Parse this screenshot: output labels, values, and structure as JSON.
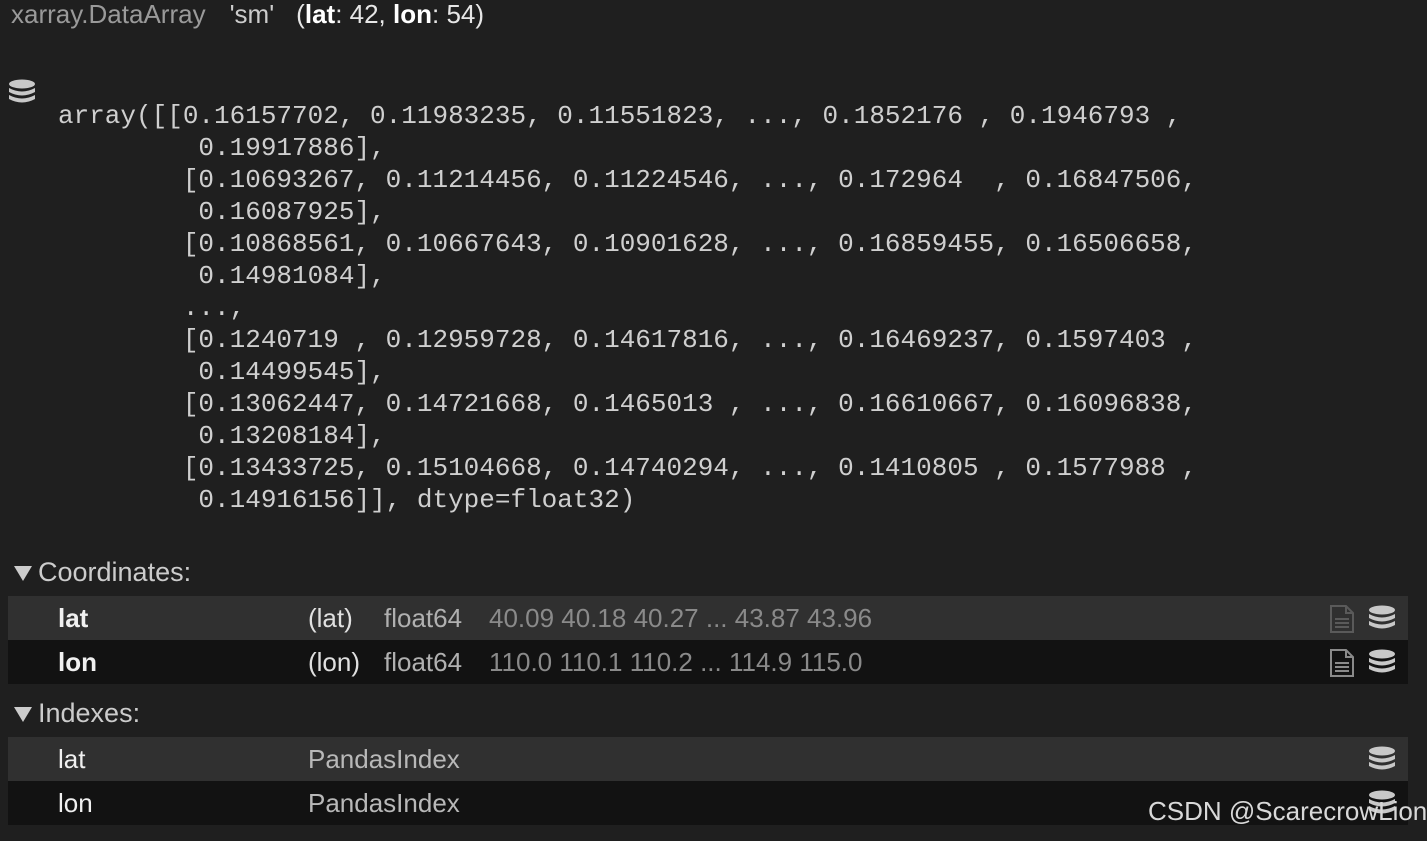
{
  "header": {
    "class_name": "xarray.DataArray",
    "var_name": "'sm'",
    "dims_open": "(",
    "dim1_name": "lat",
    "dim1_size": ": 42, ",
    "dim2_name": "lon",
    "dim2_size": ": 54)"
  },
  "array_repr": "array([[0.16157702, 0.11983235, 0.11551823, ..., 0.1852176 , 0.1946793 ,\n         0.19917886],\n        [0.10693267, 0.11214456, 0.11224546, ..., 0.172964  , 0.16847506,\n         0.16087925],\n        [0.10868561, 0.10667643, 0.10901628, ..., 0.16859455, 0.16506658,\n         0.14981084],\n        ...,\n        [0.1240719 , 0.12959728, 0.14617816, ..., 0.16469237, 0.1597403 ,\n         0.14499545],\n        [0.13062447, 0.14721668, 0.1465013 , ..., 0.16610667, 0.16096838,\n         0.13208184],\n        [0.13433725, 0.15104668, 0.14740294, ..., 0.1410805 , 0.1577988 ,\n         0.14916156]], dtype=float32)",
  "coordinates": {
    "title": "Coordinates:",
    "rows": [
      {
        "name": "lat",
        "dims": "(lat)",
        "dtype": "float64",
        "preview": "40.09 40.18 40.27 ... 43.87 43.96"
      },
      {
        "name": "lon",
        "dims": "(lon)",
        "dtype": "float64",
        "preview": "110.0 110.1 110.2 ... 114.9 115.0"
      }
    ]
  },
  "indexes": {
    "title": "Indexes:",
    "rows": [
      {
        "name": "lat",
        "type": "PandasIndex"
      },
      {
        "name": "lon",
        "type": "PandasIndex"
      }
    ]
  },
  "watermark": "CSDN @ScarecrowLion",
  "icons": {
    "data_repr": "database-icon",
    "attrs": "file-text-icon",
    "data": "database-icon"
  },
  "colors": {
    "background": "#1f1f1f",
    "row_light": "#303030",
    "row_dark": "#121212"
  }
}
